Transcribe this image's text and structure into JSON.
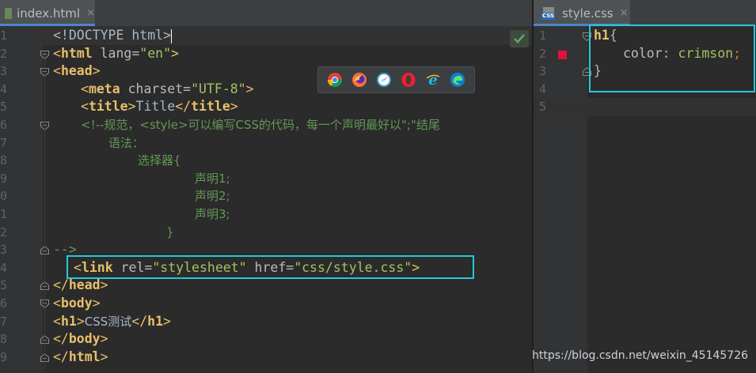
{
  "tabs": {
    "left": {
      "label": "index.html"
    },
    "right": {
      "label": "style.css",
      "badge": "CSS"
    },
    "close_glyph": "×"
  },
  "html_lines": [
    "1",
    "2",
    "3",
    "4",
    "5",
    "6",
    "7",
    "8",
    "9",
    "0",
    "1",
    "2",
    "3",
    "4",
    "5",
    "6",
    "7",
    "8",
    "9"
  ],
  "html_code": {
    "l1": {
      "doctype": "<!DOCTYPE html>"
    },
    "l2": {
      "open": "<",
      "tag": "html",
      "attr": " lang=",
      "val": "\"en\"",
      "close": ">"
    },
    "l3": {
      "open": "<",
      "tag": "head",
      "close": ">"
    },
    "l4": {
      "open": "<",
      "tag": "meta",
      "attr": " charset=",
      "val": "\"UTF-8\"",
      "close": ">"
    },
    "l5": {
      "open": "<",
      "tag": "title",
      "mid": ">",
      "text": "Title",
      "open2": "</",
      "tag2": "title",
      "close": ">"
    },
    "l6": {
      "comment": "<!--规范，<style>可以编写CSS的代码，每一个声明最好以\";\"结尾"
    },
    "l7": {
      "comment": "语法："
    },
    "l8": {
      "comment": "选择器{"
    },
    "l9": {
      "comment": "声明1;"
    },
    "l10": {
      "comment": "声明2;"
    },
    "l11": {
      "comment": "声明3;"
    },
    "l12": {
      "comment": "}"
    },
    "l13": {
      "comment": "-->"
    },
    "l14": {
      "open": "<",
      "tag": "link",
      "attr1": " rel=",
      "val1": "\"stylesheet\"",
      "attr2": " href=",
      "val2": "\"css/style.css\"",
      "close": ">"
    },
    "l15": {
      "open": "</",
      "tag": "head",
      "close": ">"
    },
    "l16": {
      "open": "<",
      "tag": "body",
      "close": ">"
    },
    "l17": {
      "open": "<",
      "tag": "h1",
      "mid": ">",
      "text": "CSS测试",
      "open2": "</",
      "tag2": "h1",
      "close": ">"
    },
    "l18": {
      "open": "</",
      "tag": "body",
      "close": ">"
    },
    "l19": {
      "open": "</",
      "tag": "html",
      "close": ">"
    }
  },
  "css_lines": [
    "1",
    "2",
    "3",
    "4",
    "5"
  ],
  "css_code": {
    "l1": {
      "selector": "h1",
      "brace": "{"
    },
    "l2": {
      "prop": "color",
      "colon": ": ",
      "value": "crimson",
      "semi": ";"
    },
    "l3": {
      "brace": "}"
    }
  },
  "browsers": [
    "chrome-icon",
    "firefox-icon",
    "safari-icon",
    "opera-icon",
    "ie-icon",
    "edge-icon"
  ],
  "colors": {
    "highlight": "#27c7d6",
    "crimson_swatch": "#dc143c",
    "tab_accent": "#4a88c7",
    "editor_bg": "#2b2b2b"
  },
  "watermark": "https://blog.csdn.net/weixin_45145726"
}
